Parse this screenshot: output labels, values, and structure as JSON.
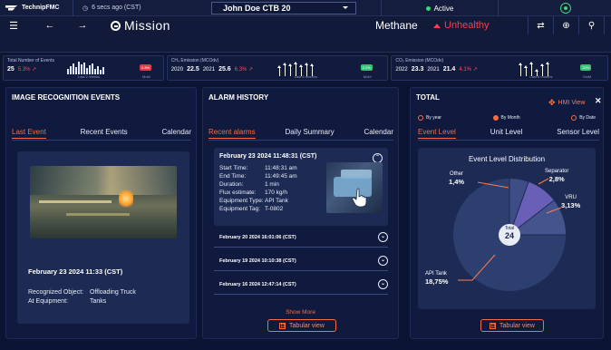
{
  "topbar": {
    "brand": "TechnipFMC",
    "last_update": "6 secs ago (CST)",
    "user": "John Doe CTB 20",
    "status": "Active"
  },
  "navbar": {
    "menu_icon": "menu-icon",
    "back_icon": "back-arrow-icon",
    "forward_icon": "forward-arrow-icon",
    "app_name": "Mission",
    "gas": "Methane",
    "health": "Unhealthy",
    "colors": {
      "unhealthy": "#ff3b4f",
      "accent": "#ff6b3b",
      "active": "#39d57a"
    }
  },
  "kpis": [
    {
      "title": "Total Number of Events",
      "value": "25",
      "delta": "5.3% ↗",
      "sub": "Last 2 Weeks",
      "badge": "2.8%",
      "badge_sub": "MoM"
    },
    {
      "title": "CH₄ Emission (MCOdv)",
      "y1": "2020",
      "v1": "22.5",
      "y2": "2021",
      "v2": "25.6",
      "delta": "6.3% ↗",
      "sub": "Last 6 months",
      "badge": "2.2%",
      "badge_sub": "MoM"
    },
    {
      "title": "CO₂ Emission (MCOdv)",
      "y1": "2022",
      "v1": "23.3",
      "y2": "2021",
      "v2": "21.4",
      "delta": "4.1% ↗",
      "sub": "Last 6 months",
      "badge": "20%",
      "badge_sub": "MoM"
    }
  ],
  "image_recognition": {
    "title": "IMAGE RECOGNITION EVENTS",
    "tabs": [
      "Last Event",
      "Recent Events",
      "Calendar"
    ],
    "date": "February 23 2024 11:33 (CST)",
    "recognized_label": "Recognized Object:",
    "recognized_value": "Offloading Truck",
    "equipment_label": "At Equipment:",
    "equipment_value": "Tanks"
  },
  "alarm_history": {
    "title": "ALARM HISTORY",
    "tabs": [
      "Recent alarms",
      "Daily Summary",
      "Calendar"
    ],
    "expanded": {
      "date": "February 23 2024 11:48:31 (CST)",
      "fields": [
        {
          "k": "Start Time:",
          "v": "11:48:31 am"
        },
        {
          "k": "End Time:",
          "v": "11:49:45 am"
        },
        {
          "k": "Duration:",
          "v": "1 min"
        },
        {
          "k": "Flux estimate:",
          "v": "170 kg/h"
        },
        {
          "k": "Equipment Type:",
          "v": "API Tank"
        },
        {
          "k": "Equipment Tag:",
          "v": "T-0802"
        }
      ]
    },
    "rows": [
      "February 20 2024 16:01:06 (CST)",
      "February 19 2024 10:10:38 (CST)",
      "February 16 2024 12:47:14 (CST)"
    ],
    "show_more": "Show More",
    "tabular": "Tabular view"
  },
  "total": {
    "title": "TOTAL",
    "hmi_view": "HMI View",
    "radios": [
      "By year",
      "By Month",
      "By Date"
    ],
    "tabs": [
      "Event Level",
      "Unit Level",
      "Sensor Level"
    ],
    "tabular": "Tabular view"
  },
  "chart_data": {
    "type": "pie",
    "title": "Event Level Distribution",
    "center_label": "Total",
    "total": "24",
    "slices": [
      {
        "name": "Other",
        "value": "1,4%"
      },
      {
        "name": "Separator",
        "value": "2,8%"
      },
      {
        "name": "VRU",
        "value": "3,13%"
      },
      {
        "name": "API Tank",
        "value": "18,75%"
      }
    ],
    "colors": {
      "main": "#2c3f6e",
      "other": "#3d4d86",
      "separator": "#6a5fb6",
      "vru": "#44548c"
    }
  }
}
